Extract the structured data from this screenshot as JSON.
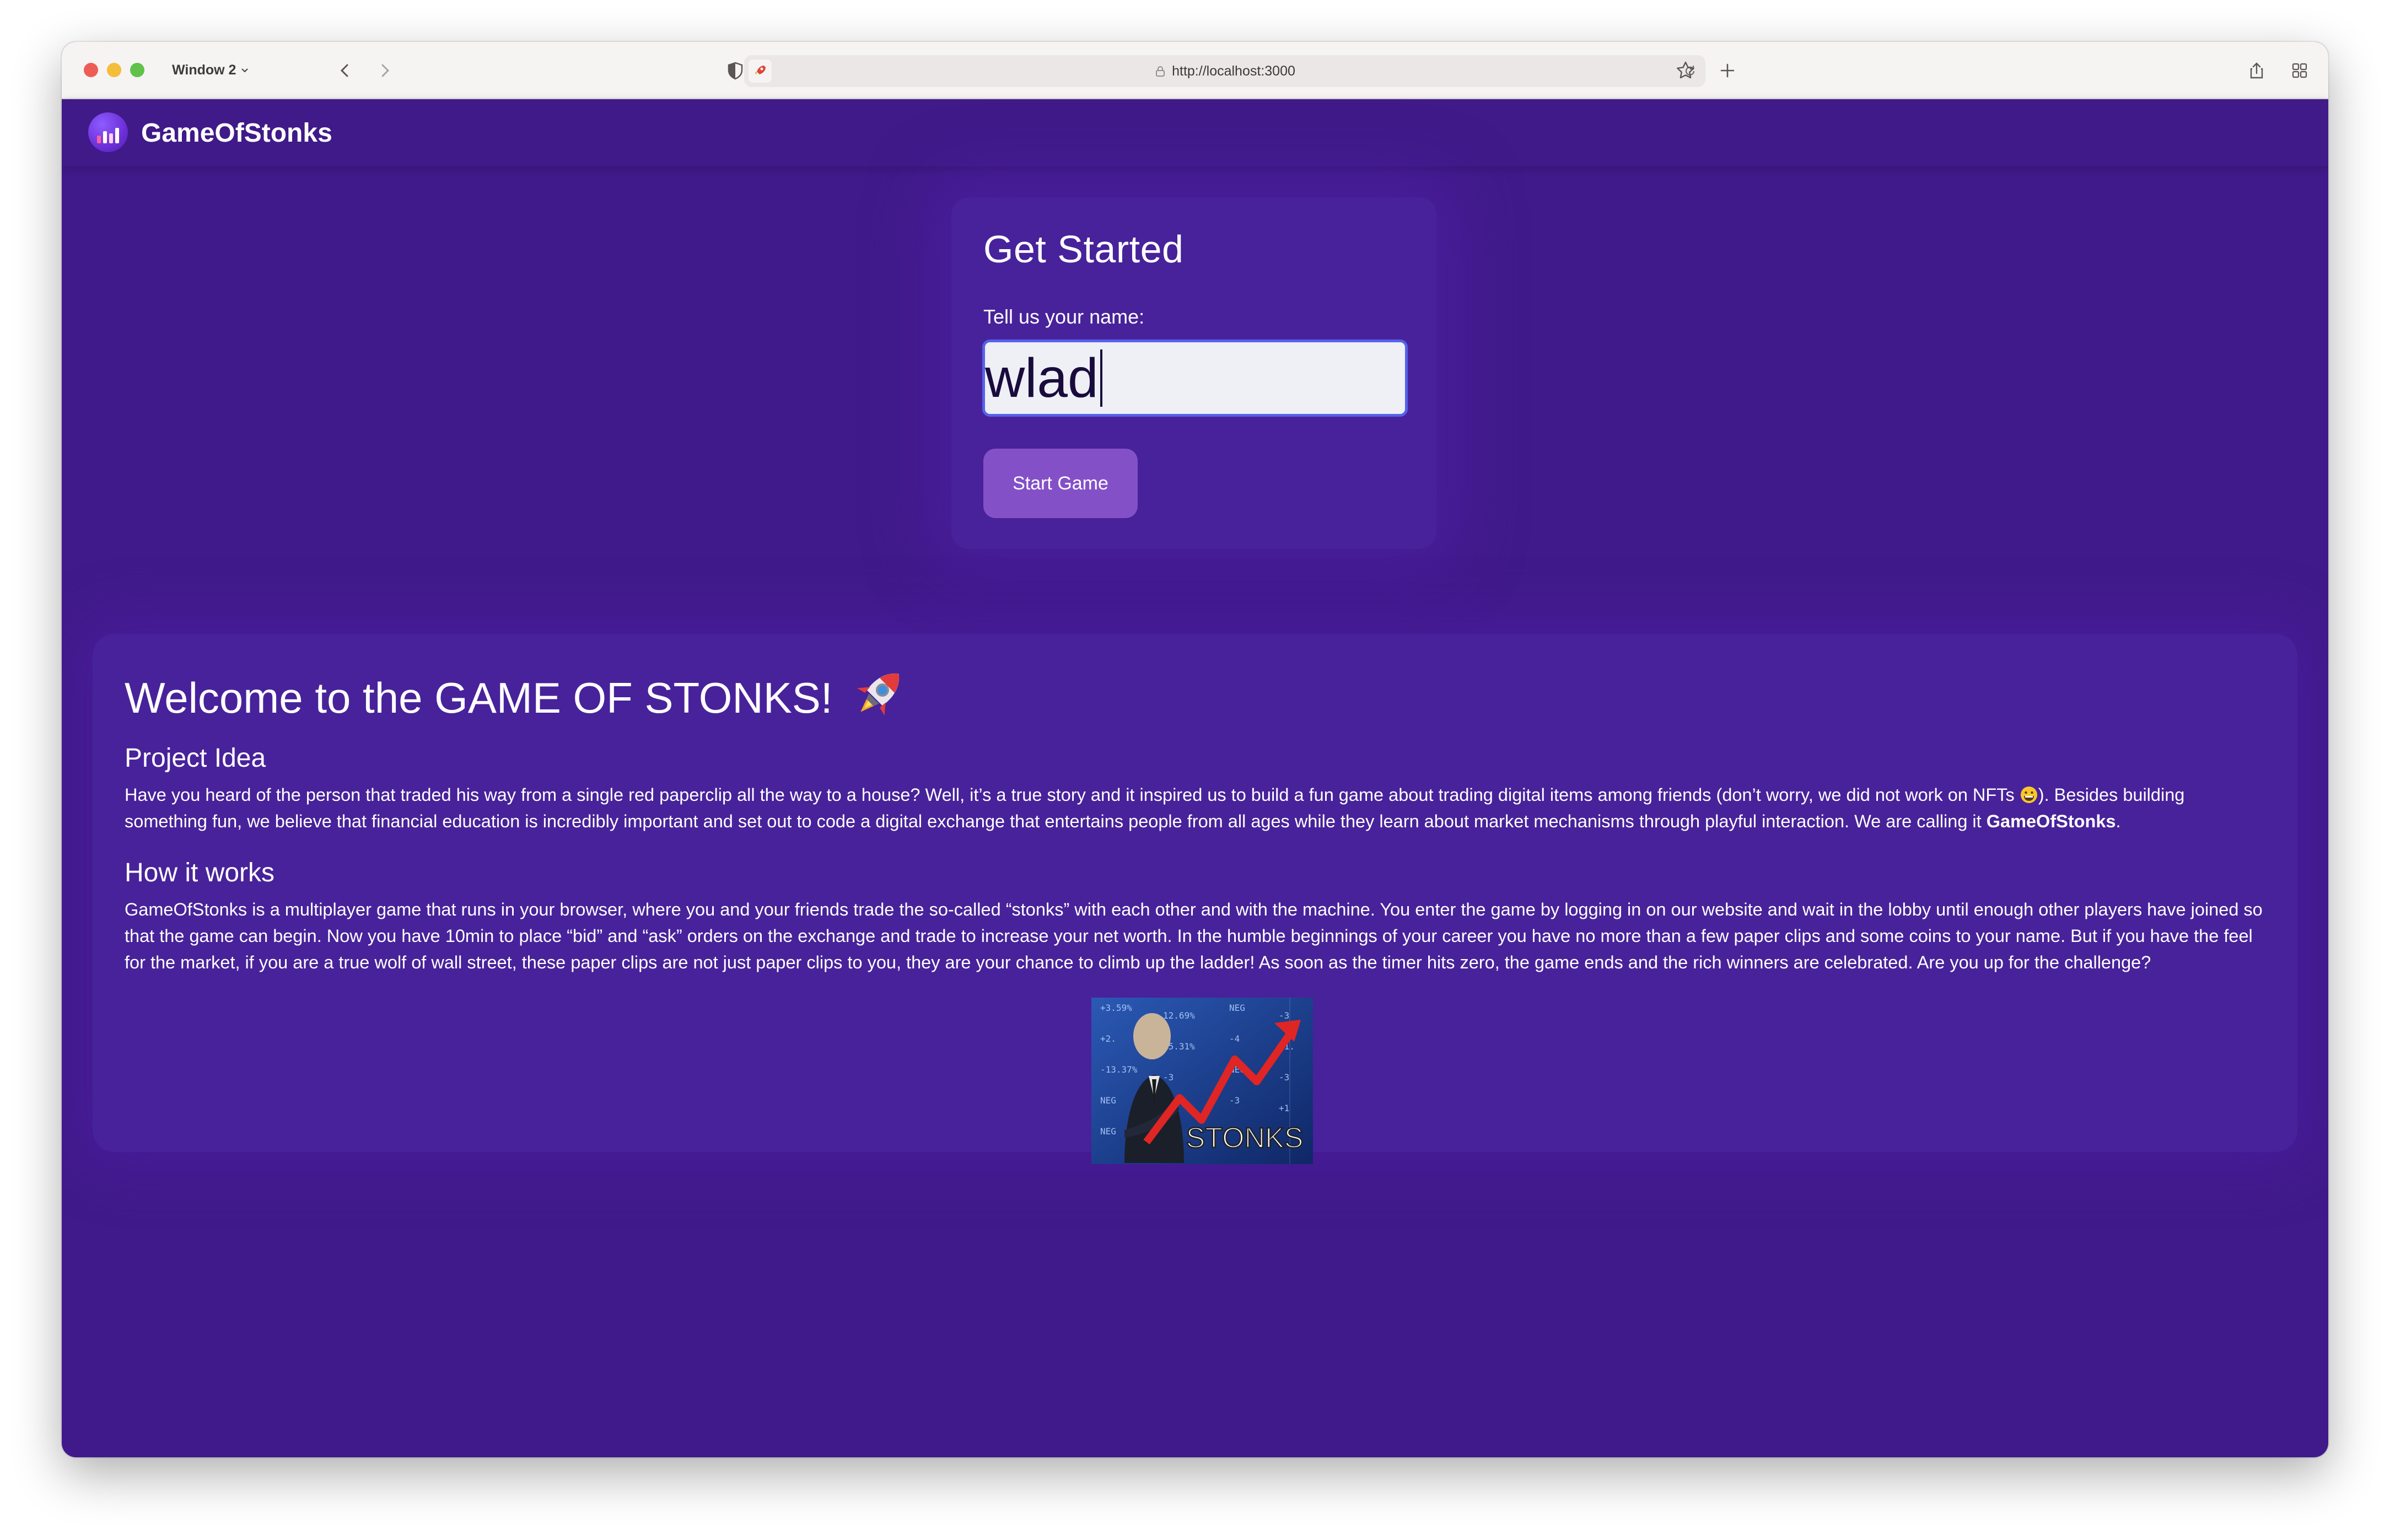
{
  "browser": {
    "window_menu": "Window 2",
    "url": "http://localhost:3000"
  },
  "app": {
    "brand": "GameOfStonks"
  },
  "get_started": {
    "title": "Get Started",
    "name_label": "Tell us your name:",
    "name_value": "wlad",
    "start_button": "Start Game"
  },
  "welcome": {
    "title": "Welcome to the GAME OF STONKS!",
    "title_emoji": "rocket",
    "project_idea_heading": "Project Idea",
    "project_idea_text_1": "Have you heard of the person that traded his way from a single red paperclip all the way to a house? Well, it’s a true story and it inspired us to build a fun game about trading digital items among friends (don’t worry, we did not work on NFTs ",
    "project_idea_emoji": "grinning-face",
    "project_idea_text_2": "). Besides building something fun, we believe that financial education is incredibly important and set out to code a digital exchange that entertains people from all ages while they learn about market mechanisms through playful interaction. We are calling it ",
    "project_idea_brand": "GameOfStonks",
    "project_idea_end": ".",
    "how_heading": "How it works",
    "how_text": "GameOfStonks is a multiplayer game that runs in your browser, where you and your friends trade the so-called “stonks” with each other and with the machine. You enter the game by logging in on our website and wait in the lobby until enough other players have joined so that the game can begin. Now you have 10min to place “bid” and “ask” orders on the exchange and trade to increase your net worth. In the humble beginnings of your career you have no more than a few paper clips and some coins to your name. But if you have the feel for the market, if you are a true wolf of wall street, these paper clips are not just paper clips to you, they are your chance to climb up the ladder! As soon as the timer hits zero, the game ends and the rich winners are celebrated. Are you up for the challenge?",
    "meme": {
      "caption": "STONKS",
      "ticker_values": [
        "+3.59%",
        "12.69%",
        "NEG",
        "-3",
        "+2.",
        "15.31%",
        "-4",
        "+1.",
        "-13.37%",
        "-3",
        "NEG",
        "-3",
        "NEG",
        "NEG",
        "-3",
        "+1",
        "NEG",
        "NEG"
      ]
    }
  },
  "colors": {
    "page_bg": "#401a8a",
    "card_bg": "#48229a",
    "button_bg": "#8450c8",
    "input_border": "#5561ea"
  }
}
